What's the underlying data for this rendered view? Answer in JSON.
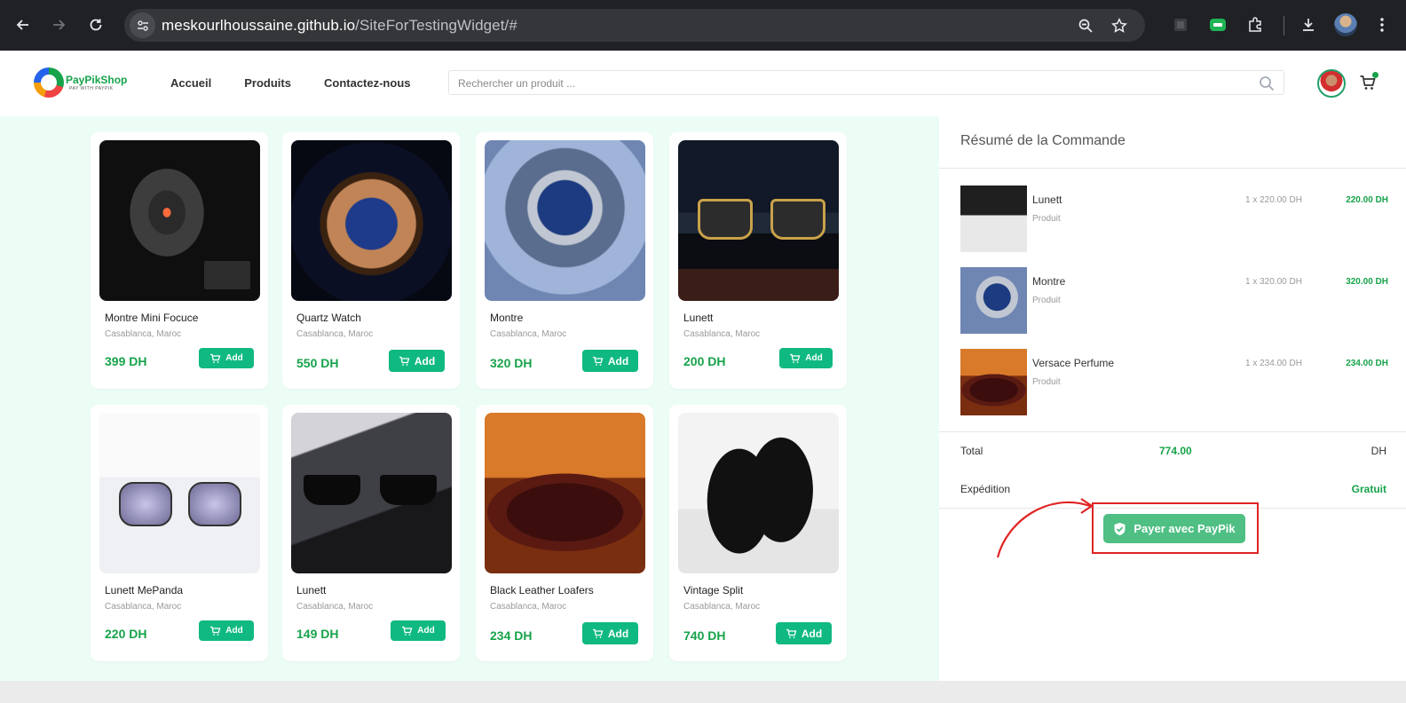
{
  "browser": {
    "url_host": "meskourlhoussaine.github.io",
    "url_path": "/SiteForTestingWidget/#"
  },
  "header": {
    "logo_text": "PayPikShop",
    "logo_tagline": "PAY WITH PAYPIK",
    "nav": [
      "Accueil",
      "Produits",
      "Contactez-nous"
    ],
    "search_placeholder": "Rechercher un produit ..."
  },
  "products": [
    {
      "name": "Montre Mini Focuce",
      "location": "Casablanca, Maroc",
      "price": "399 DH",
      "button": "Add",
      "image": "black-sport-watch"
    },
    {
      "name": "Quartz Watch",
      "location": "Casablanca, Maroc",
      "price": "550 DH",
      "button": "Add",
      "image": "quartz-watch"
    },
    {
      "name": "Montre",
      "location": "Casablanca, Maroc",
      "price": "320 DH",
      "button": "Add",
      "image": "blue-dial-watch"
    },
    {
      "name": "Lunett",
      "location": "Casablanca, Maroc",
      "price": "200 DH",
      "button": "Add",
      "image": "sunglasses"
    },
    {
      "name": "Lunett MePanda",
      "location": "Casablanca, Maroc",
      "price": "220 DH",
      "button": "Add",
      "image": "aviator-sunglasses"
    },
    {
      "name": "Lunett",
      "location": "Casablanca, Maroc",
      "price": "149 DH",
      "button": "Add",
      "image": "rimless-sunglasses"
    },
    {
      "name": "Black Leather Loafers",
      "location": "Casablanca, Maroc",
      "price": "234 DH",
      "button": "Add",
      "image": "leather-loafers"
    },
    {
      "name": "Vintage Split",
      "location": "Casablanca, Maroc",
      "price": "740 DH",
      "button": "Add",
      "image": "chelsea-boots"
    }
  ],
  "summary": {
    "title": "Résumé de la Commande",
    "items": [
      {
        "name": "Lunett",
        "sub": "Produit",
        "qty": "1 x 220.00 DH",
        "total": "220.00 DH"
      },
      {
        "name": "Montre",
        "sub": "Produit",
        "qty": "1 x 320.00 DH",
        "total": "320.00 DH"
      },
      {
        "name": "Versace Perfume",
        "sub": "Produit",
        "qty": "1 x 234.00 DH",
        "total": "234.00 DH"
      }
    ],
    "total_label": "Total",
    "total_value": "774.00",
    "total_currency": "DH",
    "shipping_label": "Expédition",
    "shipping_value": "Gratuit",
    "pay_button": "Payer avec PayPik"
  },
  "colors": {
    "accent_green": "#10b981",
    "price_green": "#16a34a",
    "annotation_red": "#e02424",
    "product_bg": "#ecfdf5"
  }
}
